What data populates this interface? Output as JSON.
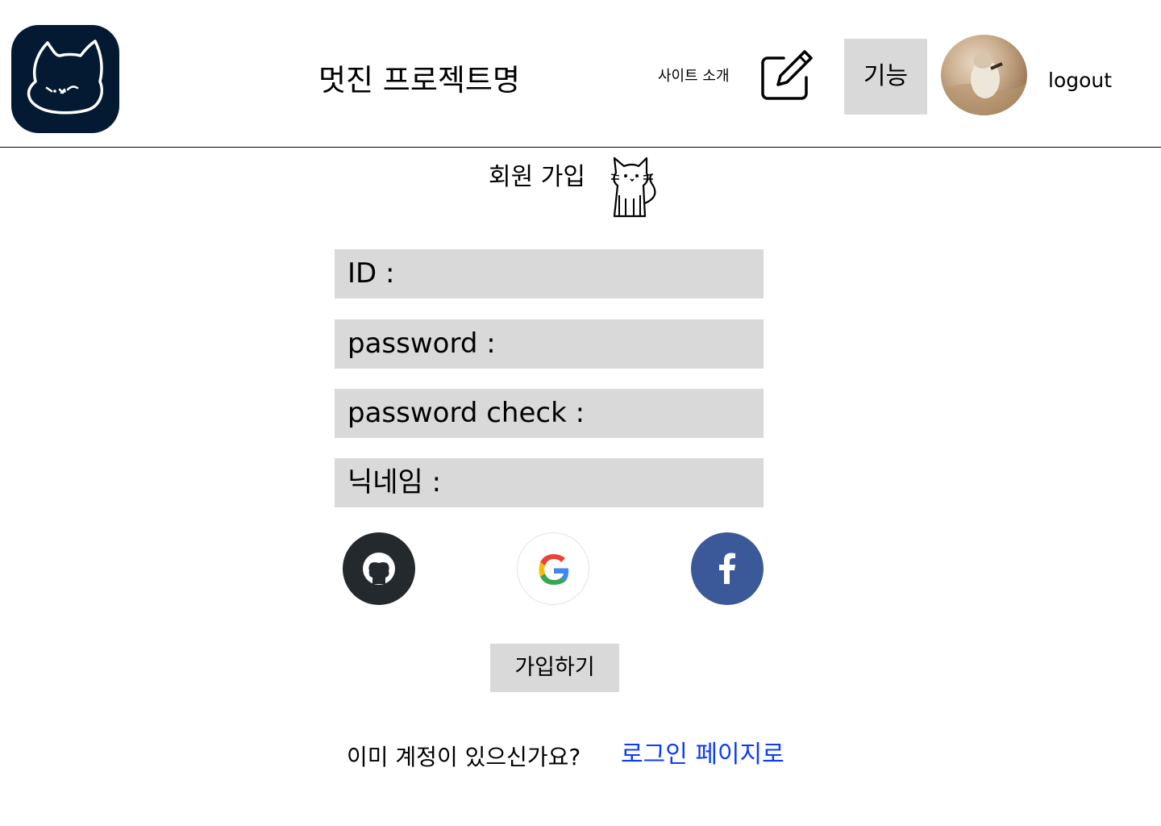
{
  "header": {
    "logo_icon": "cat-face-logo-icon",
    "title": "멋진 프로젝트명",
    "about_link": "사이트 소개",
    "edit_icon": "edit-icon",
    "feature_button": "기능",
    "avatar": "user-avatar-cat-photo",
    "logout": "logout"
  },
  "signup": {
    "title": "회원 가입",
    "title_icon": "cat-icon",
    "fields": {
      "id_label": "ID :",
      "password_label": "password :",
      "password_check_label": "password check :",
      "nickname_label": "닉네임 :"
    },
    "social": {
      "github_icon": "github-icon",
      "google_icon": "google-icon",
      "facebook_icon": "facebook-icon"
    },
    "submit_button": "가입하기",
    "have_account_text": "이미 계정이 있으신가요?",
    "login_link": "로그인 페이지로"
  },
  "colors": {
    "logo_bg": "#041a33",
    "field_bg": "#d9d9d9",
    "github": "#24292e",
    "facebook": "#3b5998",
    "link": "#0b3bff"
  }
}
